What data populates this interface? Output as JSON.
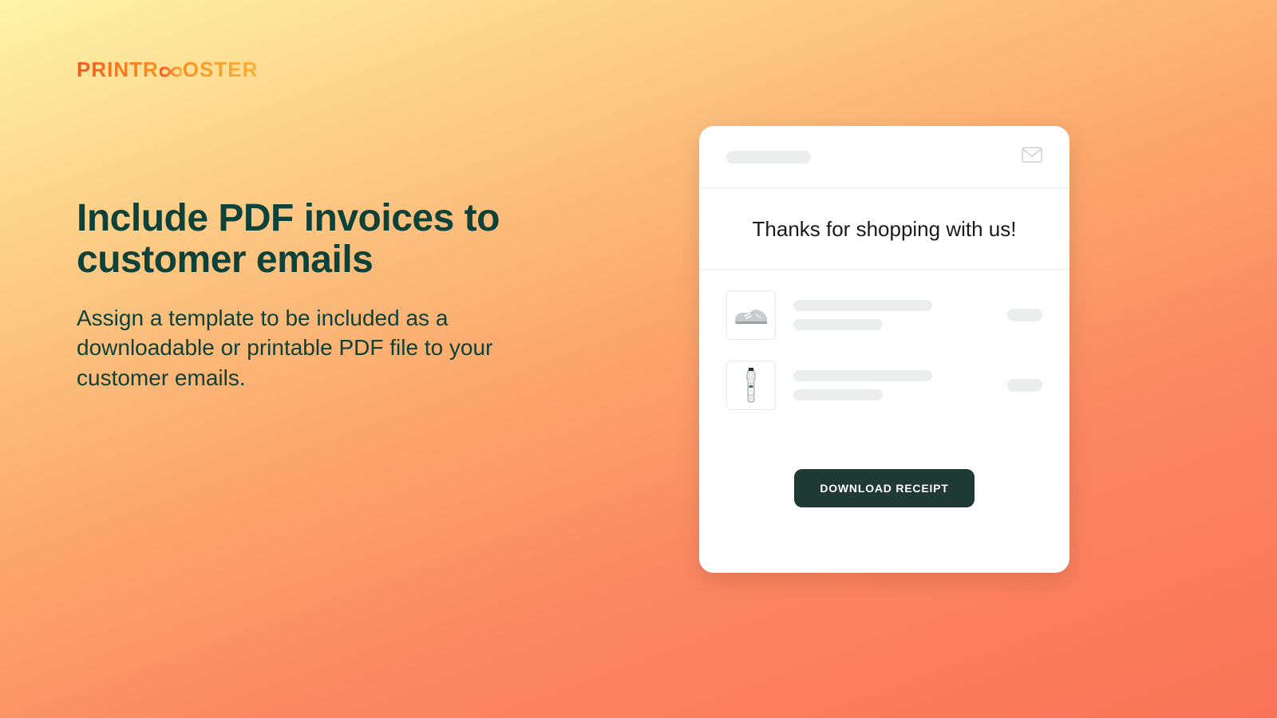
{
  "brand": {
    "part1": "PRINTR",
    "part2": "OSTER"
  },
  "headline": "Include PDF invoices to customer emails",
  "subtext": "Assign a template to be included as a downloadable or printable PDF file to your customer emails.",
  "card": {
    "thanks": "Thanks for shopping with us!",
    "download_label": "DOWNLOAD RECEIPT",
    "items": [
      {
        "icon": "sneaker-icon"
      },
      {
        "icon": "bottle-icon"
      }
    ]
  }
}
